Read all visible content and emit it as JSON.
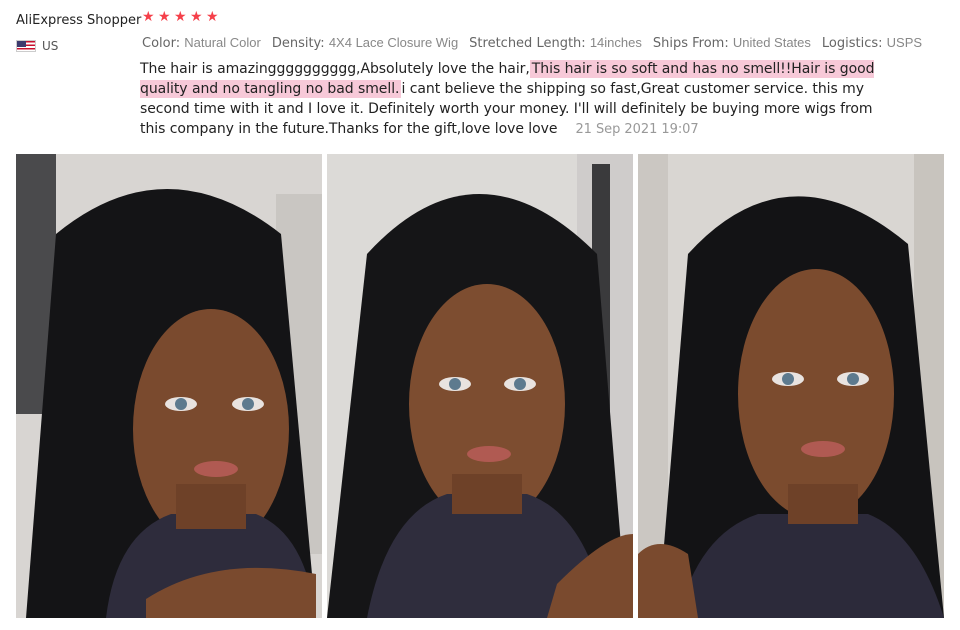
{
  "review": {
    "reviewer_name": "AliExpress Shopper",
    "rating": 5,
    "country": {
      "code": "US",
      "flag_icon": "us-flag-icon"
    },
    "attributes": [
      {
        "label": "Color:",
        "value": "Natural Color"
      },
      {
        "label": "Density:",
        "value": "4X4 Lace Closure Wig"
      },
      {
        "label": "Stretched Length:",
        "value": "14inches"
      },
      {
        "label": "Ships From:",
        "value": "United States"
      },
      {
        "label": "Logistics:",
        "value": "USPS"
      }
    ],
    "text_part1": "The hair is amazingggggggggg,Absolutely love the hair,",
    "highlight": "This hair is so soft and has no smell!!Hair is good quality and no tangling no bad smell.",
    "text_part2": "i cant believe the shipping so fast,Great customer service. this my second time with it and I love it. Definitely worth your money. I'll will definitely be buying more wigs from this company in the future.Thanks for the gift,love love love",
    "date": "21 Sep 2021 19:07",
    "highlight_color": "#f7c9d8",
    "star_color": "#f5404a"
  },
  "photos": [
    {
      "name": "review-photo-1"
    },
    {
      "name": "review-photo-2"
    },
    {
      "name": "review-photo-3"
    }
  ]
}
